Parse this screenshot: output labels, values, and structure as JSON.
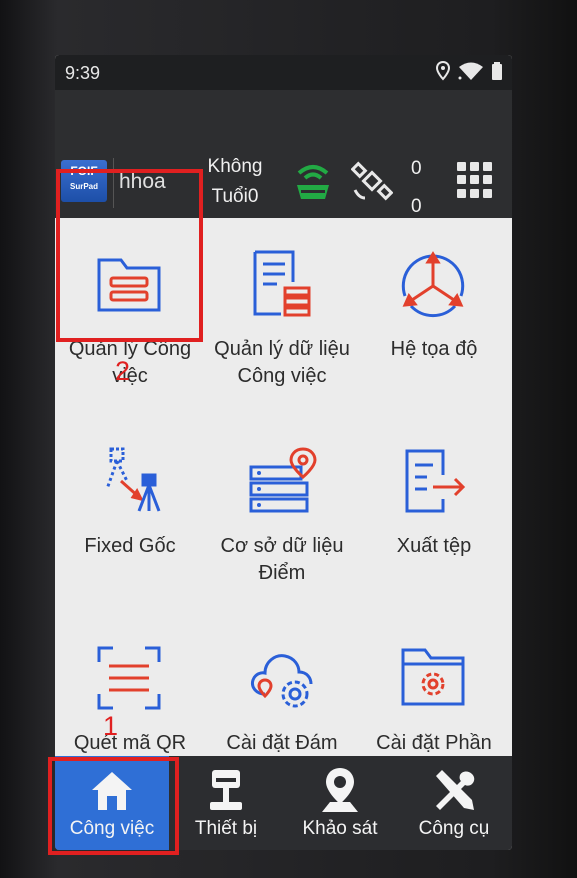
{
  "status_bar": {
    "time": "9:39"
  },
  "toolbar": {
    "user": "hhoa",
    "mode_line1": "Không",
    "mode_line2": "Tuổi0",
    "count_top": "0",
    "count_bottom": "0",
    "logo_text": "FOIF SurPad"
  },
  "tiles": [
    {
      "label": "Quản lý Công việc",
      "icon": "folder-list-icon"
    },
    {
      "label": "Quản lý dữ liệu Công việc",
      "icon": "document-database-icon"
    },
    {
      "label": "Hệ tọa độ",
      "icon": "coordinate-axes-icon"
    },
    {
      "label": "Fixed Gốc",
      "icon": "satellite-tripod-icon"
    },
    {
      "label": "Cơ sở dữ liệu Điểm",
      "icon": "server-pin-icon"
    },
    {
      "label": "Xuất tệp",
      "icon": "export-file-icon"
    },
    {
      "label": "Quét mã QR",
      "icon": "qr-scan-icon"
    },
    {
      "label": "Cài đặt Đám mây",
      "icon": "cloud-settings-icon"
    },
    {
      "label": "Cài đặt Phần mềm",
      "icon": "folder-gear-icon"
    }
  ],
  "annotations": {
    "one": "1",
    "two": "2"
  },
  "bottom_nav": [
    {
      "label": "Công việc",
      "icon": "home-icon",
      "active": true
    },
    {
      "label": "Thiết bị",
      "icon": "gnss-receiver-icon",
      "active": false
    },
    {
      "label": "Khảo sát",
      "icon": "map-pin-icon",
      "active": false
    },
    {
      "label": "Công cụ",
      "icon": "tools-icon",
      "active": false
    }
  ],
  "colors": {
    "accent": "#2f6fd6",
    "icon_blue": "#2a5fd8",
    "icon_red": "#e2402c",
    "highlight": "#e02020",
    "gnss_green": "#22aa44"
  }
}
